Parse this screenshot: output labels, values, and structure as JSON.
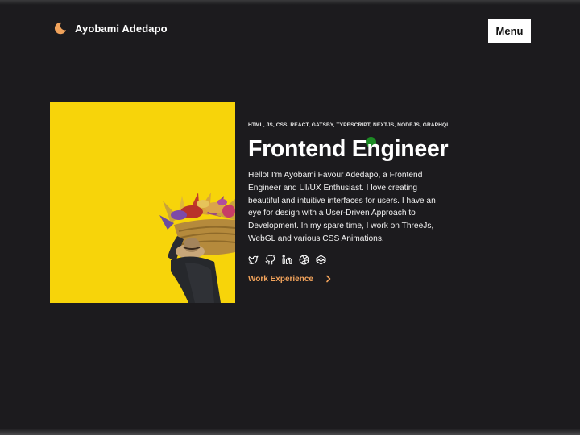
{
  "header": {
    "logo_icon": "crescent-moon-icon",
    "brand_name": "Ayobami Adedapo",
    "menu_label": "Menu"
  },
  "hero": {
    "tech_stack": "HTML, JS, CSS, REACT, GATSBY, TYPESCRIPT, NEXTJS, NODEJS, GRAPHQL.",
    "title": "Frontend Engineer",
    "bio": "Hello! I'm Ayobami Favour Adedapo, a Frontend Engineer and UI/UX Enthusiast. I love creating beautiful and intuitive interfaces for users. I have an eye for design with a User-Driven Approach to Development. In my spare time, I work on ThreeJs, WebGL and various CSS Animations.",
    "socials": [
      "twitter-icon",
      "github-icon",
      "linkedin-icon",
      "dribbble-icon",
      "codepen-icon"
    ],
    "work_link_label": "Work Experience",
    "work_link_icon": "chevron-right-icon"
  },
  "colors": {
    "background": "#1c1b1e",
    "accent": "#f0a25b",
    "image_background": "#f7d40a",
    "cursor": "#1c8a24"
  }
}
